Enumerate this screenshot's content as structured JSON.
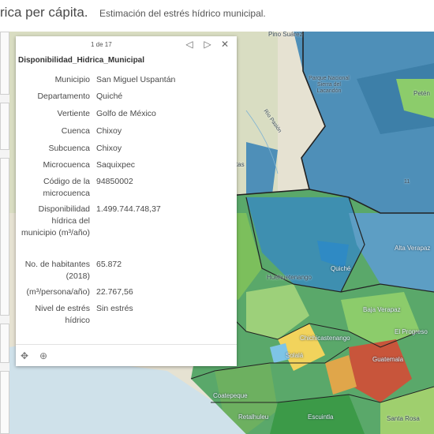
{
  "header": {
    "title": "rica per cápita.",
    "subtitle": "Estimación del estrés hídrico municipal."
  },
  "popup": {
    "pager": "1 de 17",
    "prev_icon": "◁",
    "next_icon": "▷",
    "close_icon": "✕",
    "title": "Disponibilidad_Hidrica_Municipal",
    "fields": [
      {
        "key": "Municipio",
        "value": "San Miguel Uspantán"
      },
      {
        "key": "Departamento",
        "value": "Quiché"
      },
      {
        "key": "Vertiente",
        "value": "Golfo de México"
      },
      {
        "key": "Cuenca",
        "value": "Chixoy"
      },
      {
        "key": "Subcuenca",
        "value": "Chixoy"
      },
      {
        "key": "Microcuenca",
        "value": "Saquixpec"
      },
      {
        "key": "Código de la microcuenca",
        "value": "94850002"
      },
      {
        "key": "Disponibilidad hídrica del municipio (m³/año)",
        "value": "1.499.744.748,37"
      },
      {
        "key": "No. de habitantes (2018)",
        "value": "65.872"
      },
      {
        "key": "(m³/persona/año)",
        "value": "22.767,56"
      },
      {
        "key": "Nivel de estrés hídrico",
        "value": "Sin estrés"
      }
    ],
    "footer_icons": [
      "move-icon",
      "zoom-to-icon"
    ]
  },
  "map": {
    "labels": {
      "pino_suarez": "Pino Suárez",
      "parque": "Parque Nacional Sierra del Lacandón",
      "peten": "Petén",
      "rio_pasion": "Río Pasión",
      "alta_verapaz": "Alta Verapaz",
      "quiche": "Quiché",
      "huehuetenango": "Huehuetenango",
      "baja_verapaz": "Baja Verapaz",
      "chichicastenango": "Chichicastenango",
      "el_progreso": "El Progreso",
      "guatemala": "Guatemala",
      "solola": "Solalá",
      "escuintla": "Escuintla",
      "santa_rosa": "Santa Rosa",
      "coatepeque": "Coatepeque",
      "retalhuleu": "Retalhuleu",
      "antas": "antas",
      "highway": "11"
    },
    "colors": {
      "terrain": "#e8e6d8",
      "stress_none": "#2e7dad",
      "low": "#8ccc6b",
      "mid": "#3c9a48",
      "high": "#f2d35c",
      "extreme": "#c8553b"
    }
  }
}
